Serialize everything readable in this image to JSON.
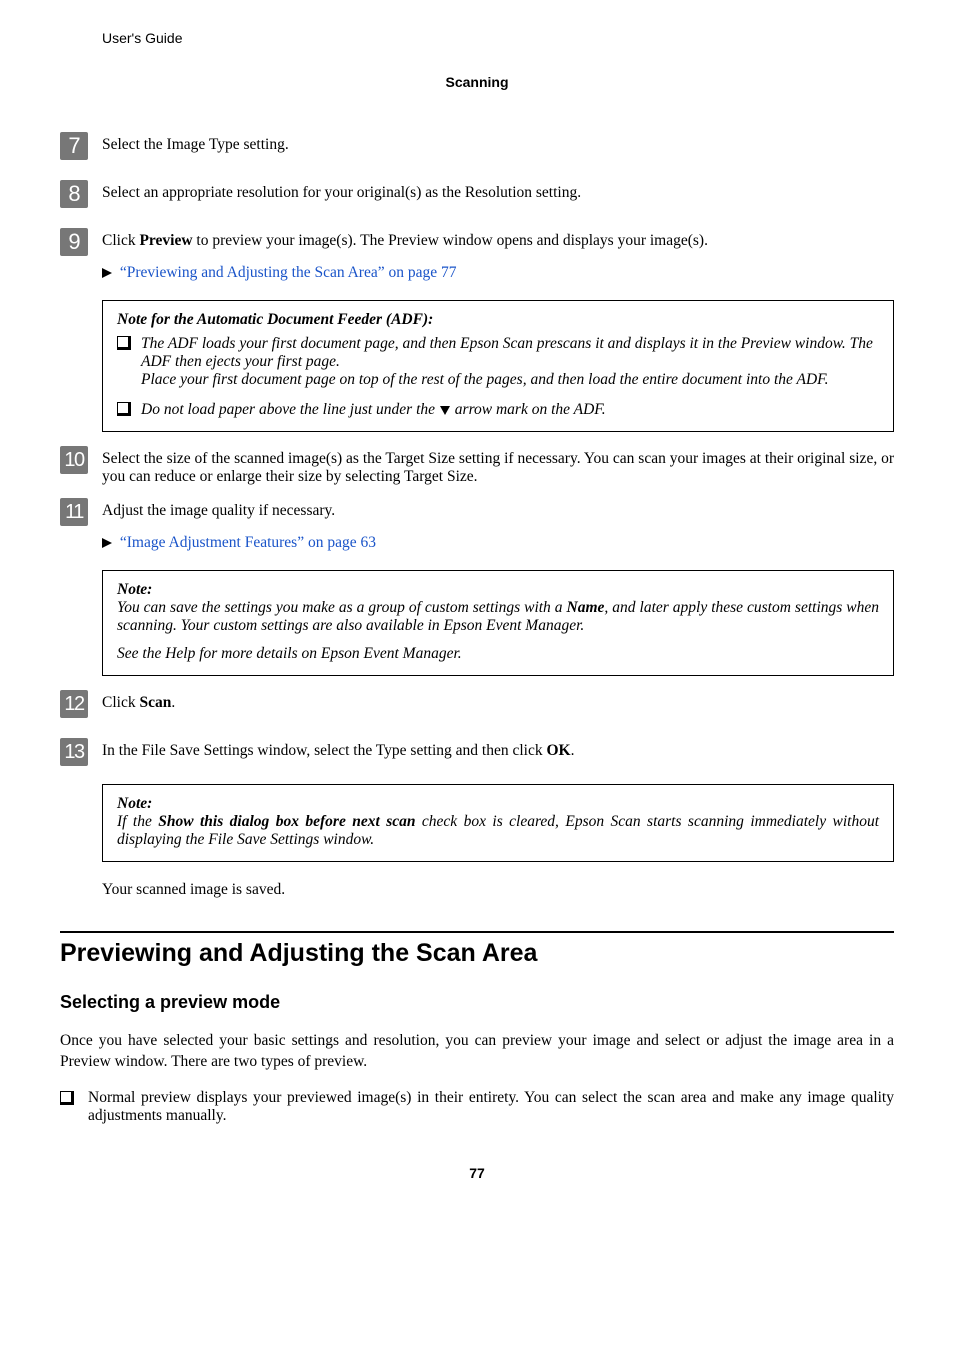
{
  "header": {
    "running_head": "User's Guide",
    "chapter": "Scanning"
  },
  "steps": {
    "s7": {
      "num": "7",
      "text": "Select the Image Type setting."
    },
    "s8": {
      "num": "8",
      "text": "Select an appropriate resolution for your original(s) as the Resolution setting."
    },
    "s9": {
      "num": "9",
      "text_before": "Click ",
      "bold": "Preview",
      "text_after": " to preview your image(s). The Preview window opens and displays your image(s).",
      "link": "“Previewing and Adjusting the Scan Area” on page 77"
    },
    "s10": {
      "num": "10",
      "text": "Select the size of the scanned image(s) as the Target Size setting if necessary. You can scan your images at their original size, or you can reduce or enlarge their size by selecting Target Size."
    },
    "s11": {
      "num": "11",
      "text": "Adjust the image quality if necessary.",
      "link": "“Image Adjustment Features” on page 63"
    },
    "s12": {
      "num": "12",
      "text_before": "Click ",
      "bold": "Scan",
      "text_after": "."
    },
    "s13": {
      "num": "13",
      "text_before": "In the File Save Settings window, select the Type setting and then click ",
      "bold": "OK",
      "text_after": "."
    }
  },
  "note_adf": {
    "title": "Note for the Automatic Document Feeder (ADF):",
    "item1a": "The ADF loads your first document page, and then Epson Scan prescans it and displays it in the Preview window. The ADF then ejects your first page.",
    "item1b": "Place your first document page on top of the rest of the pages, and then load the entire document into the ADF.",
    "item2_before": "Do not load paper above the line just under the ",
    "item2_after": " arrow mark on the ADF."
  },
  "note_name": {
    "title": "Note:",
    "line1_before": "You can save the settings you make as a group of custom settings with a ",
    "line1_bold": "Name",
    "line1_after": ", and later apply these custom settings when scanning. Your custom settings are also available in Epson Event Manager.",
    "line2": "See the Help for more details on Epson Event Manager."
  },
  "note_show": {
    "title": "Note:",
    "before": "If the ",
    "bold": "Show this dialog box before next scan",
    "after": " check box is cleared, Epson Scan starts scanning immediately without displaying the File Save Settings window."
  },
  "closing": "Your scanned image is saved.",
  "section": {
    "heading": "Previewing and Adjusting the Scan Area",
    "subheading": "Selecting a preview mode",
    "intro": "Once you have selected your basic settings and resolution, you can preview your image and select or adjust the image area in a Preview window. There are two types of preview.",
    "bullet1": "Normal preview displays your previewed image(s) in their entirety. You can select the scan area and make any image quality adjustments manually."
  },
  "pagenum": "77"
}
